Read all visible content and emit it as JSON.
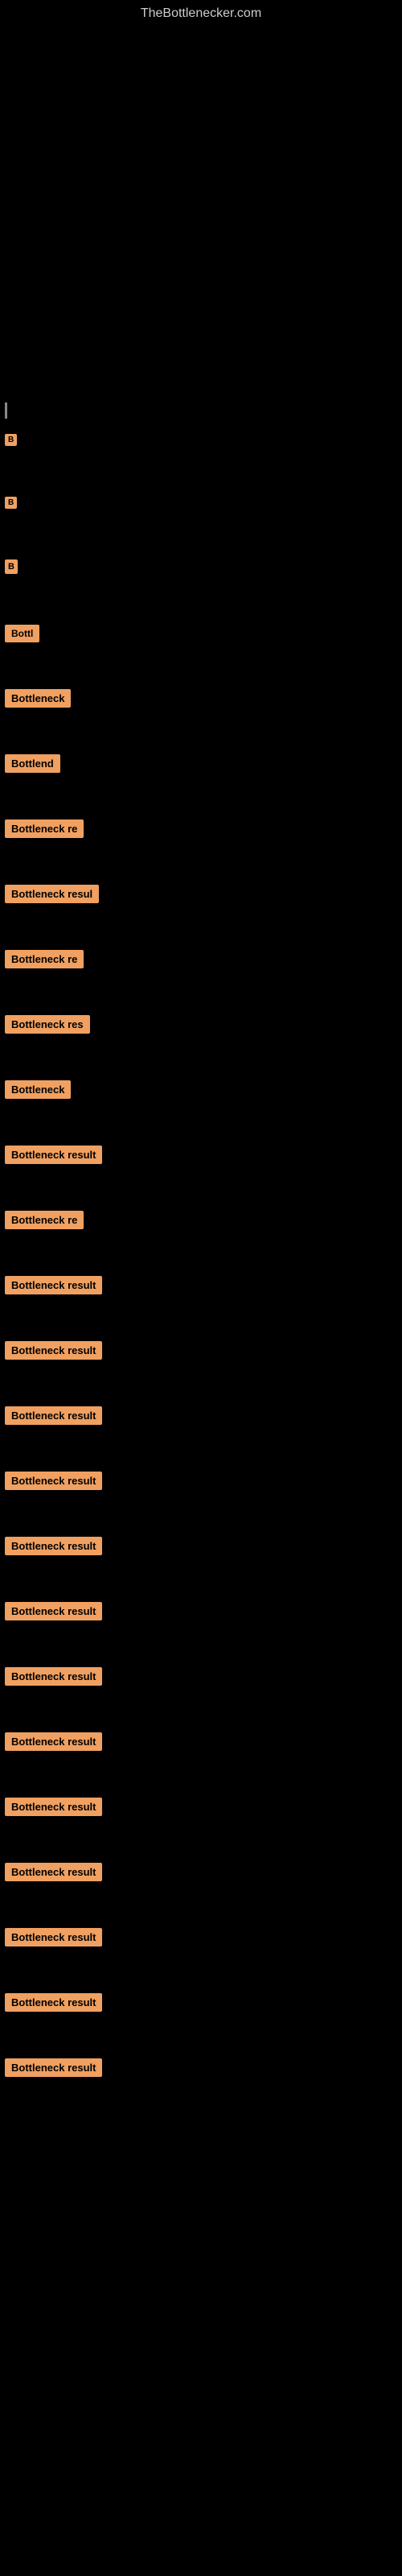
{
  "site": {
    "title": "TheBottlenecker.com"
  },
  "results": [
    {
      "id": 1,
      "label": "B",
      "width": 20
    },
    {
      "id": 2,
      "label": "B",
      "width": 20
    },
    {
      "id": 3,
      "label": "B",
      "width": 20
    },
    {
      "id": 4,
      "label": "Bottl",
      "width": 50
    },
    {
      "id": 5,
      "label": "Bottleneck",
      "width": 90
    },
    {
      "id": 6,
      "label": "Bottlene",
      "width": 75
    },
    {
      "id": 7,
      "label": "Bottleneck re",
      "width": 115
    },
    {
      "id": 8,
      "label": "Bottleneck resul",
      "width": 135
    },
    {
      "id": 9,
      "label": "Bottleneck re",
      "width": 115
    },
    {
      "id": 10,
      "label": "Bottleneck res",
      "width": 120
    },
    {
      "id": 11,
      "label": "Bottleneck",
      "width": 90
    },
    {
      "id": 12,
      "label": "Bottleneck result",
      "width": 145
    },
    {
      "id": 13,
      "label": "Bottleneck re",
      "width": 115
    },
    {
      "id": 14,
      "label": "Bottleneck result",
      "width": 145
    },
    {
      "id": 15,
      "label": "Bottleneck result",
      "width": 145
    },
    {
      "id": 16,
      "label": "Bottleneck result",
      "width": 145
    },
    {
      "id": 17,
      "label": "Bottleneck result",
      "width": 145
    },
    {
      "id": 18,
      "label": "Bottleneck result",
      "width": 145
    },
    {
      "id": 19,
      "label": "Bottleneck result",
      "width": 145
    },
    {
      "id": 20,
      "label": "Bottleneck result",
      "width": 145
    },
    {
      "id": 21,
      "label": "Bottleneck result",
      "width": 145
    },
    {
      "id": 22,
      "label": "Bottleneck result",
      "width": 145
    },
    {
      "id": 23,
      "label": "Bottleneck result",
      "width": 145
    },
    {
      "id": 24,
      "label": "Bottleneck result",
      "width": 145
    },
    {
      "id": 25,
      "label": "Bottleneck result",
      "width": 145
    },
    {
      "id": 26,
      "label": "Bottleneck result",
      "width": 145
    }
  ]
}
